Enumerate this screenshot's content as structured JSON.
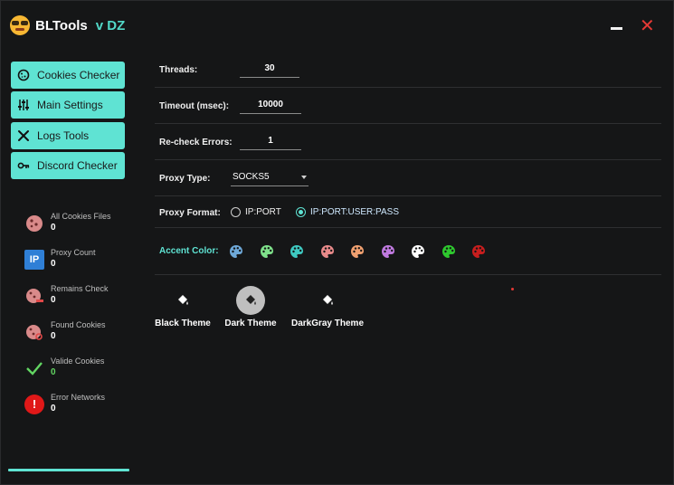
{
  "app": {
    "title": "BLTools",
    "version": "v DZ"
  },
  "window_controls": {
    "minimize_icon": "minimize-icon",
    "close_icon": "close-icon",
    "close_glyph": "✕"
  },
  "sidebar": {
    "nav": [
      {
        "label": "Cookies Checker",
        "icon": "cookie-icon",
        "glyph": "🍪"
      },
      {
        "label": "Main Settings",
        "icon": "sliders-icon",
        "glyph": "⫶"
      },
      {
        "label": "Logs Tools",
        "icon": "tools-icon",
        "glyph": "✕"
      },
      {
        "label": "Discord Checker",
        "icon": "key-icon",
        "glyph": "⚷"
      }
    ],
    "stats": [
      {
        "label": "All Cookies Files",
        "value": "0",
        "icon": "cookie-icon"
      },
      {
        "label": "Proxy Count",
        "value": "0",
        "icon": "ip-icon"
      },
      {
        "label": "Remains Check",
        "value": "0",
        "icon": "cookie-minus-icon"
      },
      {
        "label": "Found Cookies",
        "value": "0",
        "icon": "cookie-search-icon"
      },
      {
        "label": "Valide Cookies",
        "value": "0",
        "icon": "checkmark-icon"
      },
      {
        "label": "Error Networks",
        "value": "0",
        "icon": "error-icon"
      }
    ],
    "ip_badge": "IP",
    "error_badge": "!"
  },
  "settings": {
    "threads": {
      "label": "Threads:",
      "value": "30"
    },
    "timeout": {
      "label": "Timeout (msec):",
      "value": "10000"
    },
    "recheck": {
      "label": "Re-check Errors:",
      "value": "1"
    },
    "proxy_type": {
      "label": "Proxy Type:",
      "value": "SOCKS5"
    },
    "proxy_format": {
      "label": "Proxy Format:",
      "options": [
        "IP:PORT",
        "IP:PORT:USER:PASS"
      ],
      "selected": "IP:PORT:USER:PASS"
    },
    "accent": {
      "label": "Accent Color:",
      "colors": [
        "#6ea8d8",
        "#7ee08a",
        "#3ec8c0",
        "#e88a8a",
        "#f0a070",
        "#c07ae0",
        "#ffffff",
        "#2ec82e",
        "#c81e1e"
      ]
    },
    "themes": [
      {
        "name": "Black Theme",
        "icon": "paint-bucket-icon",
        "active": false
      },
      {
        "name": "Dark Theme",
        "icon": "paint-bucket-icon",
        "active": true
      },
      {
        "name": "DarkGray Theme",
        "icon": "paint-bucket-icon",
        "active": false
      }
    ]
  },
  "colors": {
    "accent": "#5fe3d3",
    "close": "#e53935",
    "background": "#151617"
  }
}
